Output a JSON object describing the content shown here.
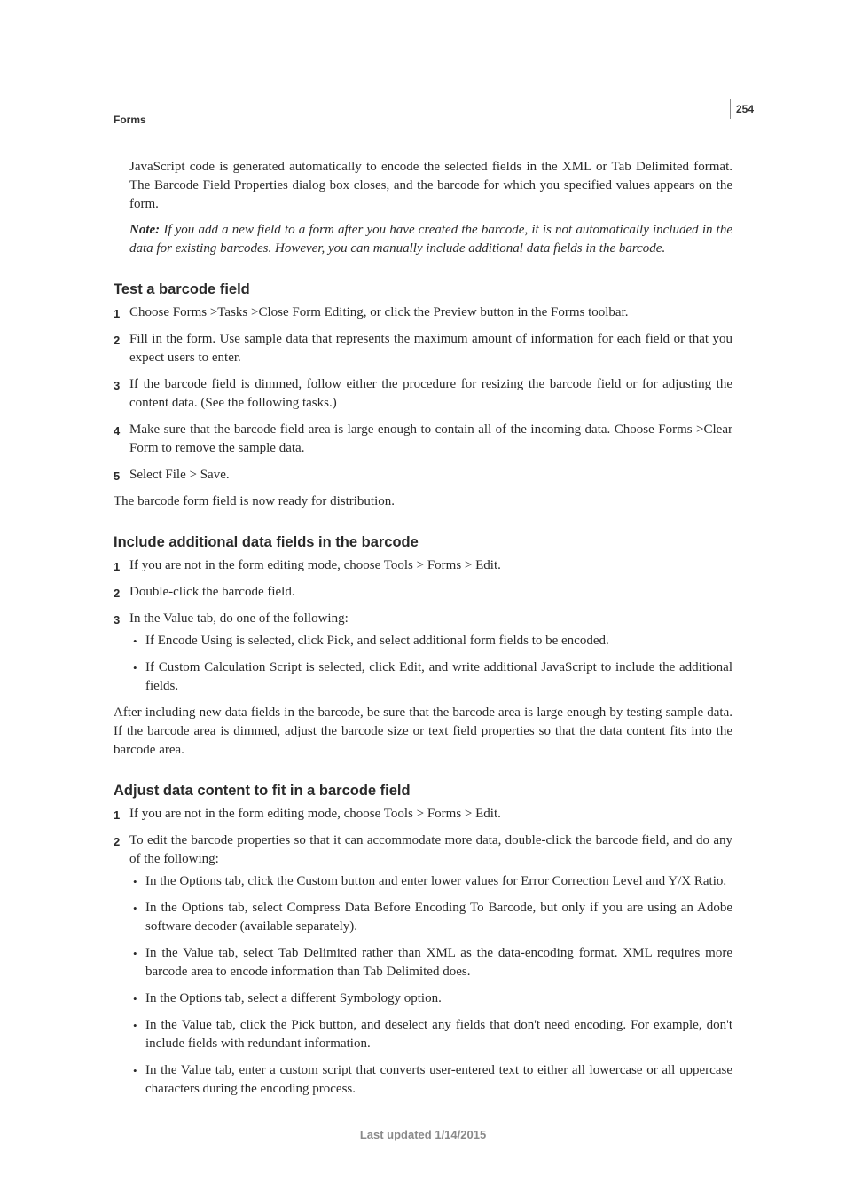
{
  "header": {
    "section": "Forms",
    "page_number": "254"
  },
  "intro": {
    "para": "JavaScript code is generated automatically to encode the selected fields in the XML or Tab Delimited format. The Barcode Field Properties dialog box closes, and the barcode for which you specified values appears on the form.",
    "note_label": "Note:",
    "note_text": " If you add a new field to a form after you have created the barcode, it is not automatically included in the data for existing barcodes. However, you can manually include additional data fields in the barcode."
  },
  "sec1": {
    "title": "Test a barcode field",
    "steps": [
      "Choose Forms >Tasks >Close Form Editing, or click the Preview button in the Forms toolbar.",
      "Fill in the form. Use sample data that represents the maximum amount of information for each field or that you expect users to enter.",
      "If the barcode field is dimmed, follow either the procedure for resizing the barcode field or for adjusting the content data. (See the following tasks.)",
      "Make sure that the barcode field area is large enough to contain all of the incoming data. Choose Forms >Clear Form to remove the sample data.",
      "Select File > Save."
    ],
    "after": "The barcode form field is now ready for distribution."
  },
  "sec2": {
    "title": "Include additional data fields in the barcode",
    "steps": [
      "If you are not in the form editing mode, choose Tools > Forms > Edit.",
      "Double-click the barcode field.",
      "In the Value tab, do one of the following:"
    ],
    "bullets": [
      "If Encode Using is selected, click Pick, and select additional form fields to be encoded.",
      "If Custom Calculation Script is selected, click Edit, and write additional JavaScript to include the additional fields."
    ],
    "after": "After including new data fields in the barcode, be sure that the barcode area is large enough by testing sample data. If the barcode area is dimmed, adjust the barcode size or text field properties so that the data content fits into the barcode area."
  },
  "sec3": {
    "title": "Adjust data content to fit in a barcode field",
    "steps": [
      "If you are not in the form editing mode, choose Tools > Forms > Edit.",
      "To edit the barcode properties so that it can accommodate more data, double-click the barcode field, and do any of the following:"
    ],
    "bullets": [
      "In the Options tab, click the Custom button and enter lower values for Error Correction Level and Y/X Ratio.",
      "In the Options tab, select Compress Data Before Encoding To Barcode, but only if you are using an Adobe software decoder (available separately).",
      "In the Value tab, select Tab Delimited rather than XML as the data-encoding format. XML requires more barcode area to encode information than Tab Delimited does.",
      "In the Options tab, select a different Symbology option.",
      "In the Value tab, click the Pick button, and deselect any fields that don't need encoding. For example, don't include fields with redundant information.",
      "In the Value tab, enter a custom script that converts user-entered text to either all lowercase or all uppercase characters during the encoding process."
    ]
  },
  "footer": {
    "text": "Last updated 1/14/2015"
  }
}
